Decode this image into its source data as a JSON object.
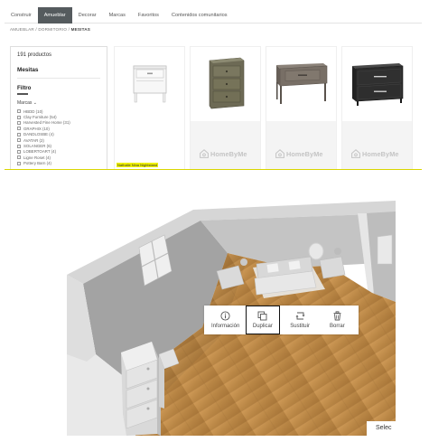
{
  "catalog": {
    "nav_tabs": [
      "Construir",
      "Amueblar",
      "Decorar",
      "Marcas",
      "Favoritos",
      "Contenidos comunitarios"
    ],
    "active_tab": "Amueblar",
    "breadcrumb": {
      "items": [
        "AMUEBLAR",
        "DORMITORIO",
        "MESITAS"
      ],
      "separator": "/"
    },
    "product_count": "191 productos",
    "category_title": "Mesitas",
    "filter_title": "Filtro",
    "brands_label": "Marcas",
    "brands": [
      "HBDD (10)",
      "Clay Furniture (54)",
      "Harvested Fine Home (31)",
      "GRAPHIX (10)",
      "DANDLOSBE (4)",
      "AVATAR (2)",
      "SOLANGER (6)",
      "LOBERTOART (4)",
      "Ligne Roset (4)",
      "Pottery Barn (4)"
    ],
    "products": [
      {
        "name": "Nathalie Nina Nightstand",
        "highlighted": true
      },
      {
        "brand_logo": "HomeByMe"
      },
      {
        "brand_logo": "HomeByMe"
      },
      {
        "brand_logo": "HomeByMe"
      }
    ],
    "accent_color": "#eef000"
  },
  "planner": {
    "toolbar": [
      {
        "label": "Información",
        "icon": "info-icon"
      },
      {
        "label": "Duplicar",
        "icon": "duplicate-icon",
        "selected": true
      },
      {
        "label": "Sustituir",
        "icon": "replace-icon"
      },
      {
        "label": "Borrar",
        "icon": "trash-icon"
      }
    ],
    "select_label": "Selec"
  }
}
